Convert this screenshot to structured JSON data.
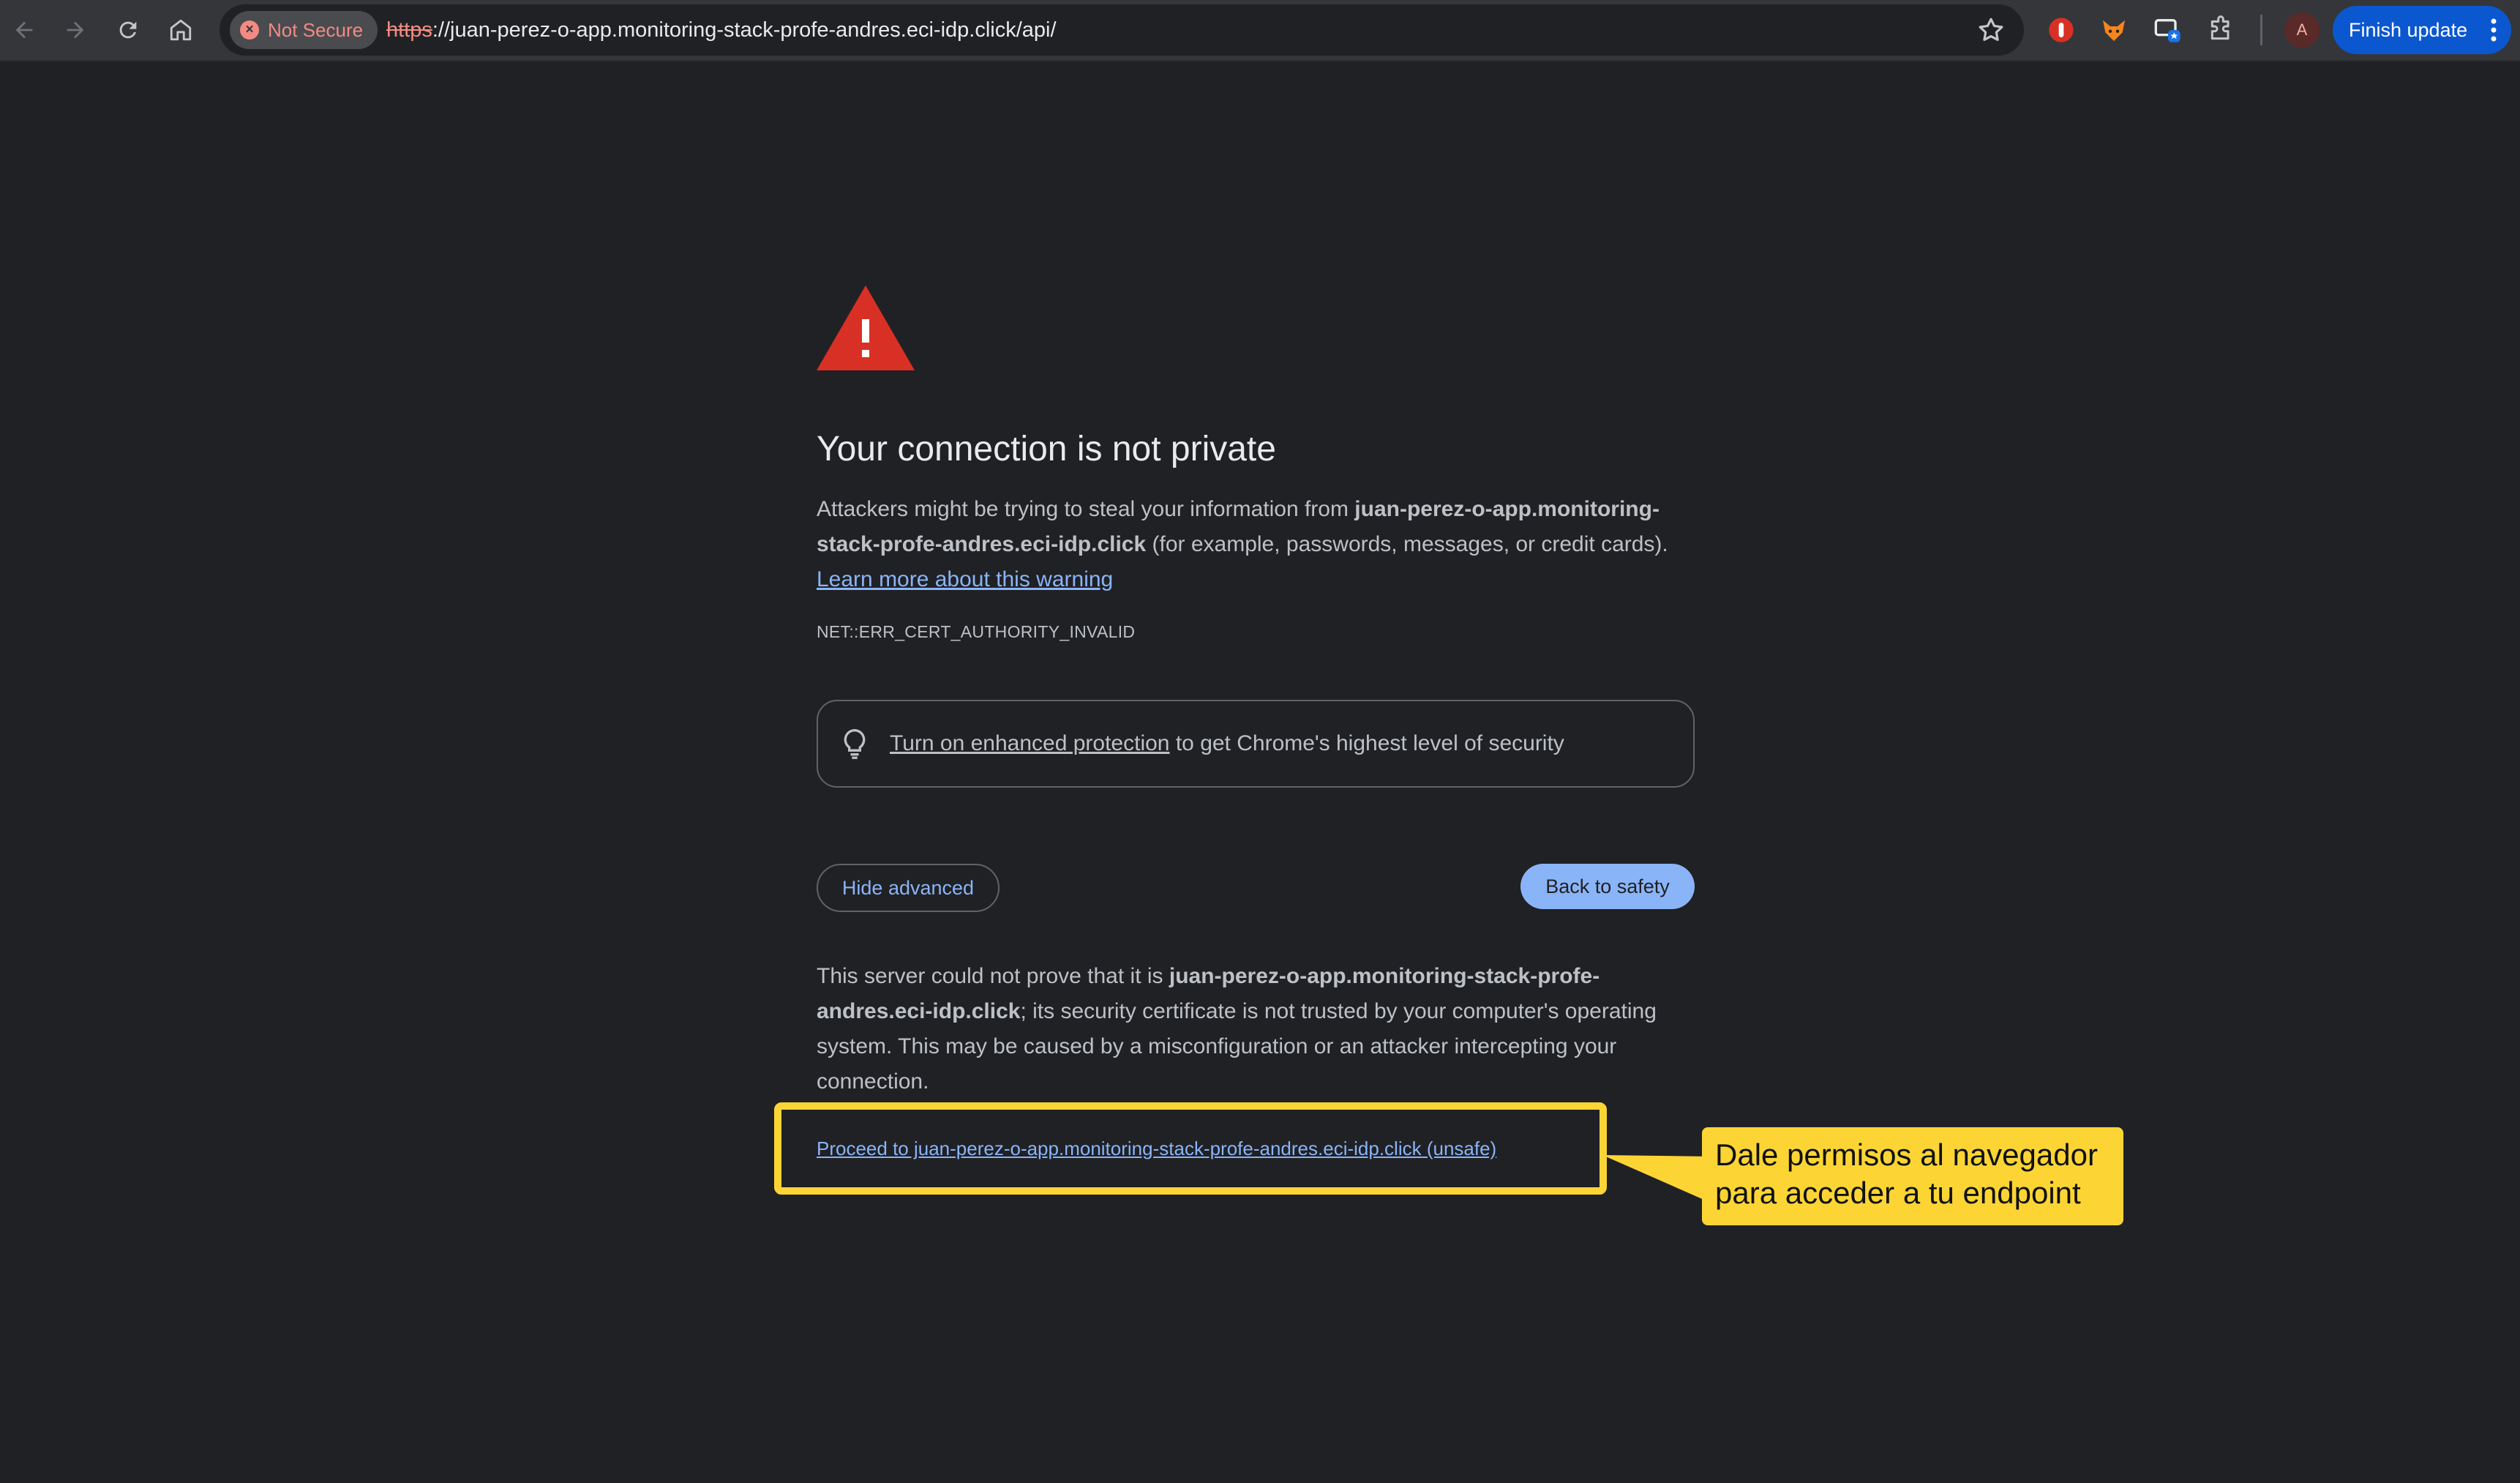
{
  "browser": {
    "security_chip": "Not Secure",
    "url_scheme": "https",
    "url_rest": "://juan-perez-o-app.monitoring-stack-profe-andres.eci-idp.click/api/",
    "avatar_initial": "A",
    "finish_update_label": "Finish update",
    "icons": [
      "back-icon",
      "forward-icon",
      "reload-icon",
      "home-icon",
      "bookmark-star-icon",
      "extension-icons",
      "puzzle-icon",
      "kebab-menu-icon"
    ]
  },
  "interstitial": {
    "title": "Your connection is not private",
    "para1_a": "Attackers might be trying to steal your information from ",
    "host_bold": "juan-perez-o-app.monitoring-stack-profe-andres.eci-idp.click",
    "para1_b": " (for example, passwords, messages, or credit cards). ",
    "learn_more": "Learn more about this warning",
    "error_code": "NET::ERR_CERT_AUTHORITY_INVALID",
    "enhanced_link": "Turn on enhanced protection",
    "enhanced_rest": " to get Chrome's highest level of security",
    "hide_advanced": "Hide advanced",
    "back_to_safety": "Back to safety",
    "details_a": "This server could not prove that it is ",
    "details_host": "juan-perez-o-app.monitoring-stack-profe-andres.eci-idp.click",
    "details_b": "; its security certificate is not trusted by your computer's operating system. This may be caused by a misconfiguration or an attacker intercepting your connection.",
    "proceed_link": "Proceed to juan-perez-o-app.monitoring-stack-profe-andres.eci-idp.click (unsafe)"
  },
  "annotation": {
    "callout_line1": "Dale permisos al navegador",
    "callout_line2": "para acceder a tu endpoint",
    "highlight_color": "#fcd535"
  },
  "colors": {
    "page_bg": "#202124",
    "text": "#bdc1c6",
    "link": "#8ab4f8",
    "warning_red": "#d93025",
    "not_secure": "#f28b82"
  }
}
